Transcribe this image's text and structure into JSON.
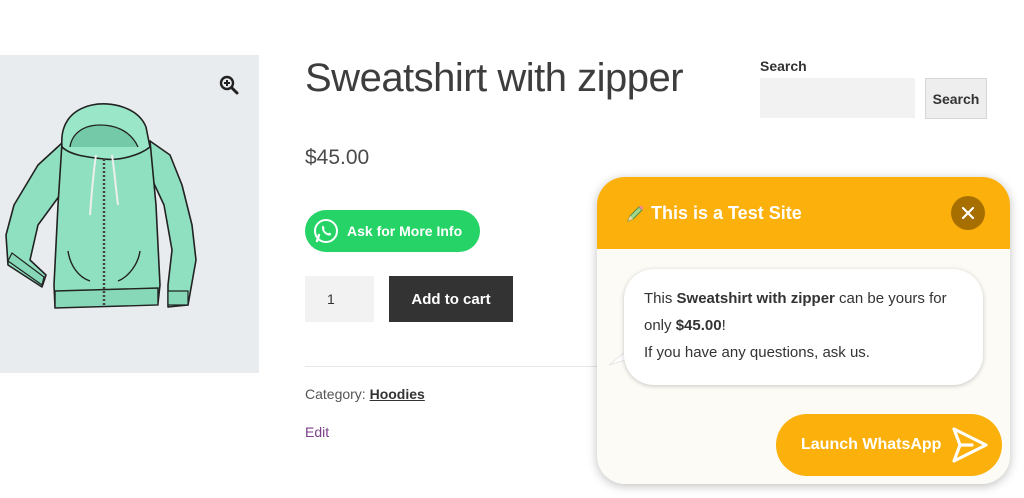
{
  "product": {
    "title": "Sweatshirt with zipper",
    "price": "$45.00",
    "whatsapp_button": "Ask for More Info",
    "quantity": "1",
    "add_to_cart": "Add to cart",
    "category_label": "Category:",
    "category_value": "Hoodies",
    "edit_link": "Edit"
  },
  "search": {
    "label": "Search",
    "button": "Search",
    "value": ""
  },
  "chat_widget": {
    "title": "This is a Test Site",
    "message_parts": {
      "p1": "This ",
      "product": "Sweatshirt with zipper",
      "p2": " can be yours for only ",
      "price": "$45.00",
      "p3": "!",
      "line2": "If you have any questions, ask us."
    },
    "launch_button": "Launch WhatsApp"
  },
  "icons": {
    "zoom": "zoom-in-icon",
    "whatsapp": "whatsapp-icon",
    "pencil": "pencil-icon",
    "close": "close-icon",
    "send": "send-icon"
  },
  "colors": {
    "whatsapp_green": "#25d366",
    "widget_accent": "#fbb00c",
    "close_bg": "#a66f00",
    "cart_button": "#333333",
    "edit_link": "#7b3f8c"
  }
}
